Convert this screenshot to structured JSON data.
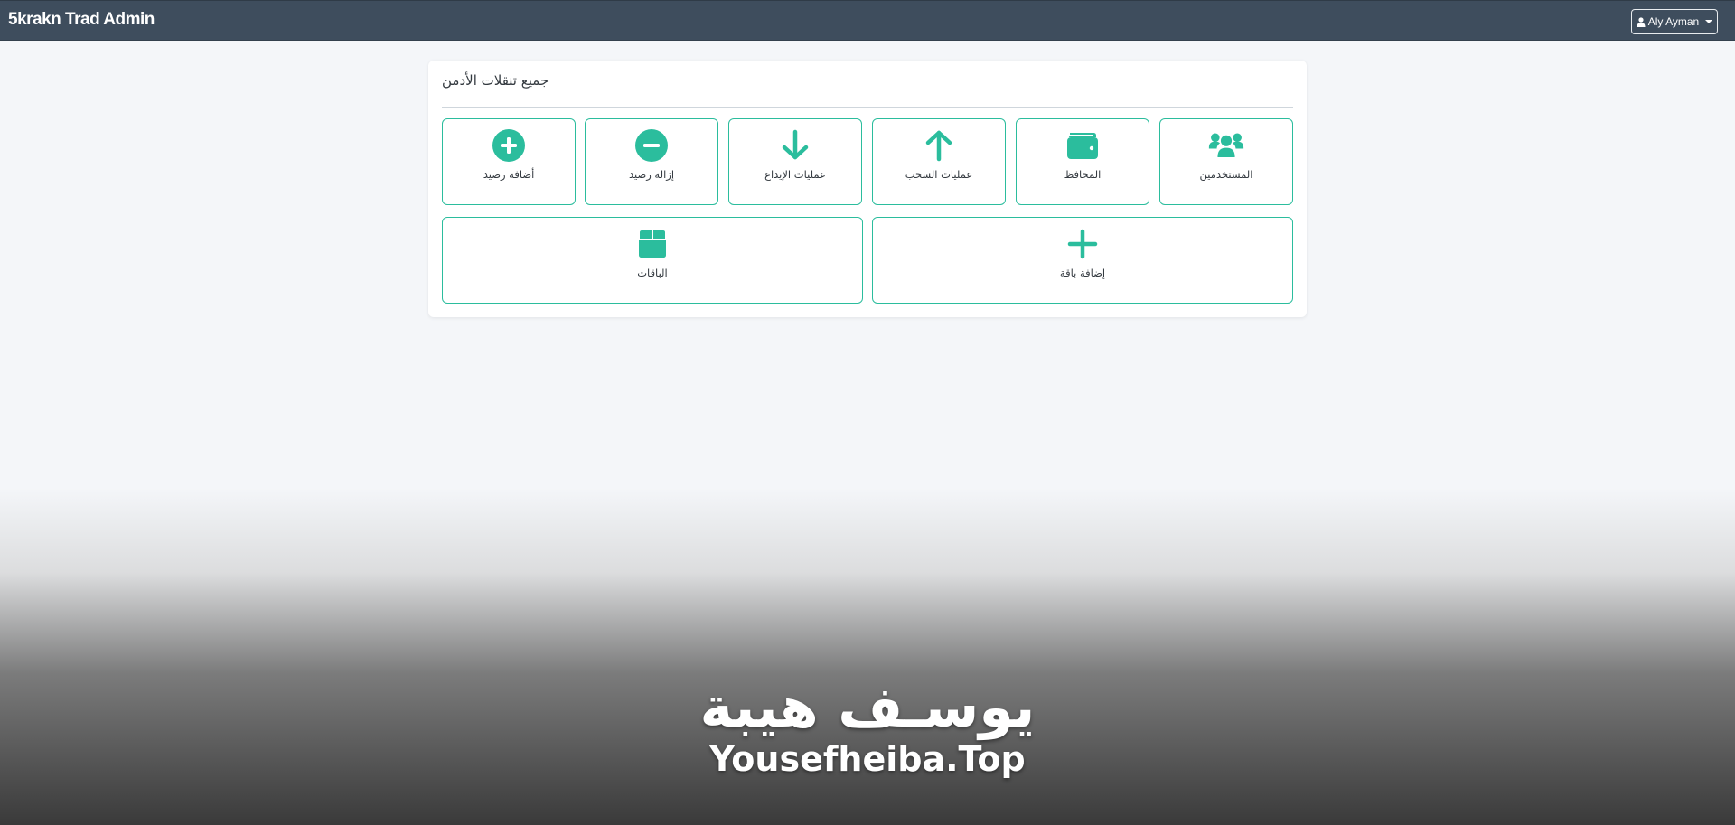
{
  "navbar": {
    "brand": "5krakn Trad Admin",
    "user_label": "Aly Ayman",
    "user_icon": "user-icon",
    "dropdown_icon": "chevron-down-icon"
  },
  "card": {
    "title": "جميع تنقلات الأدمن",
    "tiles_row1": [
      {
        "label": "المستخدمين",
        "icon": "users-icon"
      },
      {
        "label": "المحافظ",
        "icon": "wallet-icon"
      },
      {
        "label": "عمليات السحب",
        "icon": "arrow-up-icon"
      },
      {
        "label": "عمليات الإيداع",
        "icon": "arrow-down-icon"
      },
      {
        "label": "إزالة رصيد",
        "icon": "minus-circle-icon"
      },
      {
        "label": "أضافة رصيد",
        "icon": "plus-circle-icon"
      }
    ],
    "tiles_row2": [
      {
        "label": "إضافة باقة",
        "icon": "plus-icon"
      },
      {
        "label": "الباقات",
        "icon": "box-icon"
      }
    ]
  },
  "watermark": {
    "arabic": "يوسـف هيبة",
    "latin": "Yousefheiba.Top"
  },
  "colors": {
    "navbar_bg": "#3e4d5d",
    "accent": "#2bbd9d",
    "page_bg": "#f4f6f9"
  }
}
